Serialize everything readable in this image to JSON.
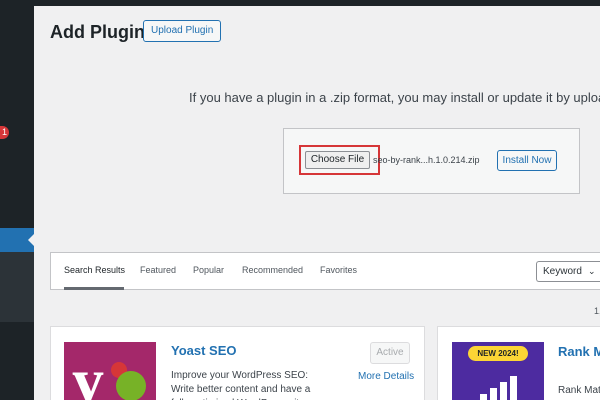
{
  "header": {
    "page_title": "Add Plugins",
    "upload_plugin_label": "Upload Plugin"
  },
  "sidebar": {
    "update_badge": "1"
  },
  "upload": {
    "description": "If you have a plugin in a .zip format, you may install or update it by uploading it here.",
    "choose_file_label": "Choose File",
    "selected_file": "seo-by-rank...h.1.0.214.zip",
    "install_now_label": "Install Now"
  },
  "filter": {
    "tabs": [
      {
        "label": "Search Results",
        "current": true
      },
      {
        "label": "Featured",
        "current": false
      },
      {
        "label": "Popular",
        "current": false
      },
      {
        "label": "Recommended",
        "current": false
      },
      {
        "label": "Favorites",
        "current": false
      }
    ],
    "search_type": "Keyword",
    "results_count": "1,"
  },
  "plugins": [
    {
      "name": "Yoast SEO",
      "description": "Improve your WordPress SEO: Write better content and have a fully optimized WordPress site",
      "status_button": "Active",
      "more_details": "More Details",
      "icon": "yoast-seo-icon"
    },
    {
      "name": "Rank Math SEO Tool",
      "description": "Rank Math",
      "badge": "NEW 2024!",
      "icon": "rank-math-icon"
    }
  ],
  "colors": {
    "admin_bar": "#1d2327",
    "accent": "#2271b1",
    "highlight_border": "#d63638",
    "yoast_brand": "#a4286a",
    "rank_math_brand": "#4d2ba0"
  }
}
